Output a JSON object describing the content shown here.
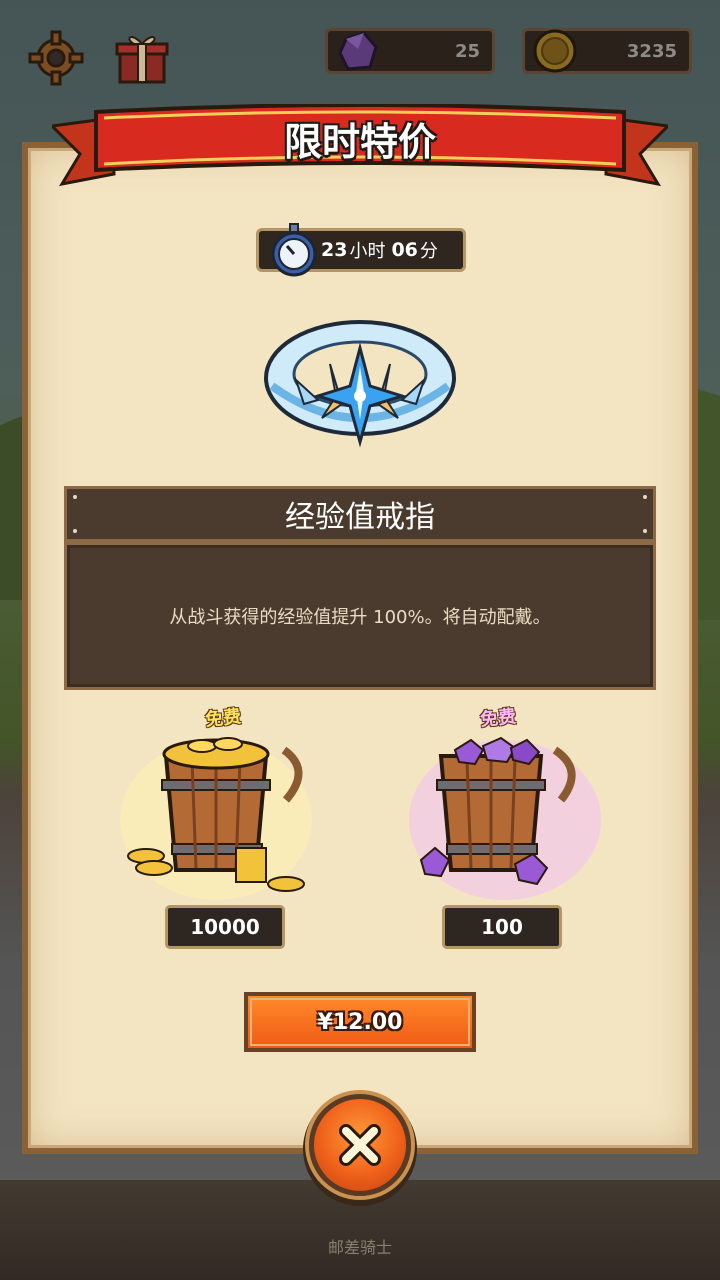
{
  "header": {
    "gem_count": "25",
    "coin_count": "3235"
  },
  "offer": {
    "title": "限时特价",
    "timer_hours": "23",
    "timer_hours_unit": "小时",
    "timer_minutes": "06",
    "timer_minutes_unit": "分",
    "item_name": "经验值戒指",
    "item_description": "从战斗获得的经验值提升 100%。将自动配戴。",
    "rewards": [
      {
        "free_label": "免费",
        "amount": "10000",
        "icon": "gold-coin-bucket-icon"
      },
      {
        "free_label": "免费",
        "amount": "100",
        "icon": "purple-gem-bucket-icon"
      }
    ],
    "price_label": "¥12.00"
  },
  "footer": {
    "text": "邮差骑士"
  },
  "colors": {
    "accent": "#f05a14",
    "ribbon": "#d6261e",
    "panel": "#f3e4c2",
    "dark_box": "#4a3b2e"
  }
}
